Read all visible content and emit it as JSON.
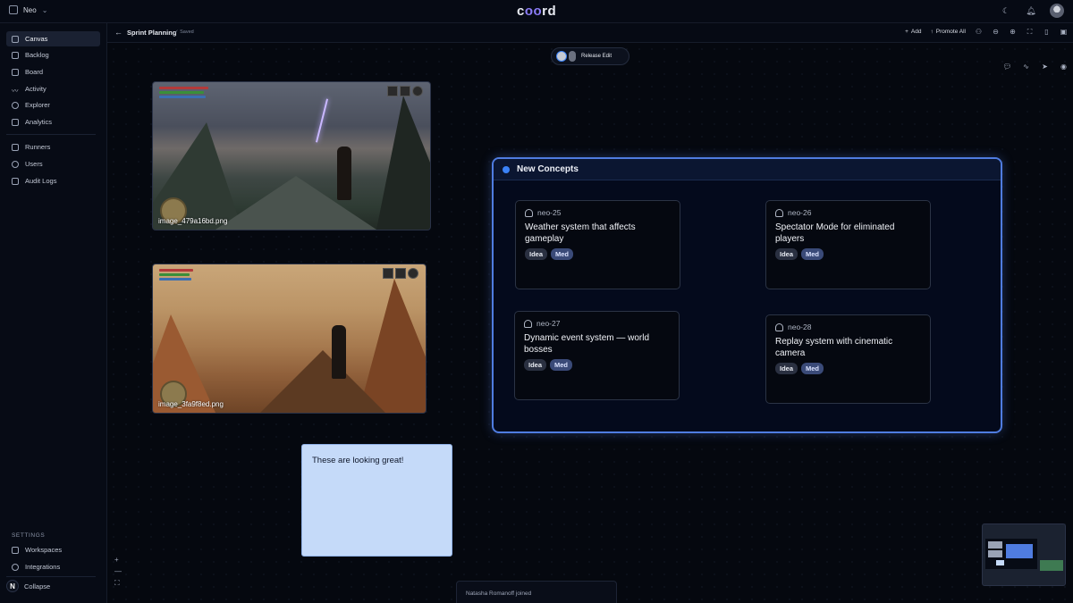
{
  "topbar": {
    "workspace_name": "Neo",
    "logo_text_a": "c",
    "logo_text_b": "oo",
    "logo_text_c": "rd"
  },
  "sidebar": {
    "items": [
      {
        "label": "Canvas",
        "active": true
      },
      {
        "label": "Backlog"
      },
      {
        "label": "Board"
      },
      {
        "label": "Activity"
      },
      {
        "label": "Explorer"
      },
      {
        "label": "Analytics"
      },
      {
        "label": "Runners"
      },
      {
        "label": "Users"
      },
      {
        "label": "Audit Logs"
      }
    ],
    "settings_label": "SETTINGS",
    "settings_items": [
      {
        "label": "Workspaces"
      },
      {
        "label": "Integrations"
      }
    ],
    "collapse_label": "Collapse",
    "collapse_badge": "N"
  },
  "subheader": {
    "title": "Sprint Planning",
    "saved": "✓ Saved",
    "add_label": "Add",
    "promote_label": "Promote All"
  },
  "canvas": {
    "release_label": "Release Edit",
    "images": [
      {
        "filename": "image_479a16bd.png"
      },
      {
        "filename": "image_3fa9f8ed.png"
      }
    ],
    "group": {
      "title": "New Concepts",
      "accent": "#3b82f6",
      "cards": [
        {
          "id": "neo-25",
          "title": "Weather system that affects gameplay",
          "tags": [
            "Idea",
            "Med"
          ]
        },
        {
          "id": "neo-26",
          "title": "Spectator Mode for eliminated players",
          "tags": [
            "Idea",
            "Med"
          ]
        },
        {
          "id": "neo-27",
          "title": "Dynamic event system — world bosses",
          "tags": [
            "Idea",
            "Med"
          ]
        },
        {
          "id": "neo-28",
          "title": "Replay system with cinematic camera",
          "tags": [
            "Idea",
            "Med"
          ]
        }
      ]
    },
    "sticky_note": "These are looking great!",
    "toast": "Natasha Romanoff joined",
    "zoom": {
      "plus": "+",
      "minus": "—",
      "fit": "⛶"
    }
  }
}
